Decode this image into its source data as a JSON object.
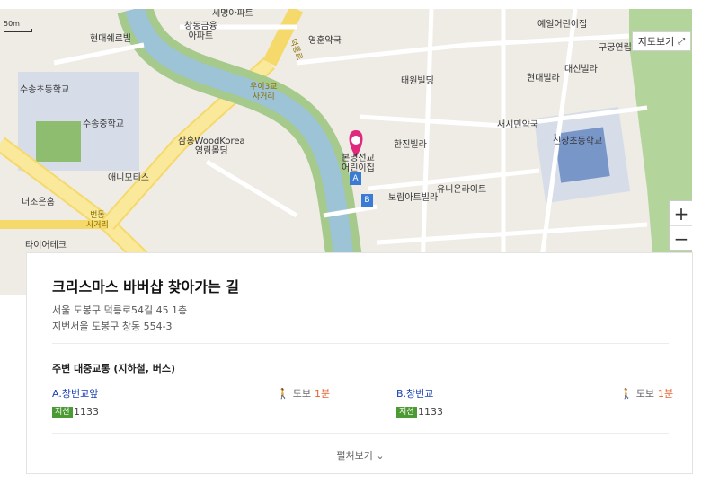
{
  "map": {
    "scale_label": "50m",
    "view_button": "지도보기",
    "zoom_in": "+",
    "zoom_out": "−",
    "labels": {
      "semyeong": "세명아파트",
      "changdong_geumyung": "창동금융\n아파트",
      "hyundai": "현대쉐르빌",
      "yeonghun": "영훈약국",
      "deokneung": "덕릉로",
      "ui3gyo": "우이3교\n사거리",
      "taewon": "태원빌딩",
      "suseong_elem": "수송초등학교",
      "suseong_mid": "수송중학교",
      "samhong": "삼홍WoodKorea\n영림몰딩",
      "hanjin": "한진빌라",
      "sinsi": "새시민약국",
      "sinchang_elem": "신창초등학교",
      "bonmyeong": "본명선교\n어린이집",
      "annimotis": "애니모티스",
      "borami": "보람아트빌라",
      "unionlight": "유니온라이트",
      "theeunhome": "더조은홈",
      "beondong": "번동\n사거리",
      "tile": "타이어테크",
      "yeeul": "예일어린이집",
      "gugong": "구궁연립",
      "daesin": "대신빌라",
      "hyundaivilla": "현대빌라",
      "stop_a": "A",
      "stop_b": "B"
    }
  },
  "place": {
    "name": "크리스마스 바버샵 찾아가는 길",
    "road_address": "서울 도봉구 덕릉로54길 45 1층",
    "lot_address": "지번서울 도봉구 창동 554-3"
  },
  "transit": {
    "section_title": "주변 대중교통 (지하철, 버스)",
    "stops": [
      {
        "letter": "A.",
        "name": "창번교앞",
        "walk_label": "도보",
        "walk_time": "1분",
        "bus_type": "지선",
        "bus_number": "1133"
      },
      {
        "letter": "B.",
        "name": "창번교",
        "walk_label": "도보",
        "walk_time": "1분",
        "bus_type": "지선",
        "bus_number": "1133"
      }
    ],
    "expand_label": "펼쳐보기"
  },
  "colors": {
    "accent_pin": "#e0287d",
    "link_blue": "#1a3fb5",
    "walk_orange": "#e8602d",
    "bus_green": "#4c9a33",
    "stream": "#9cc3d6",
    "road_yellow": "#f7e27a",
    "park_green": "#a6c98c"
  }
}
